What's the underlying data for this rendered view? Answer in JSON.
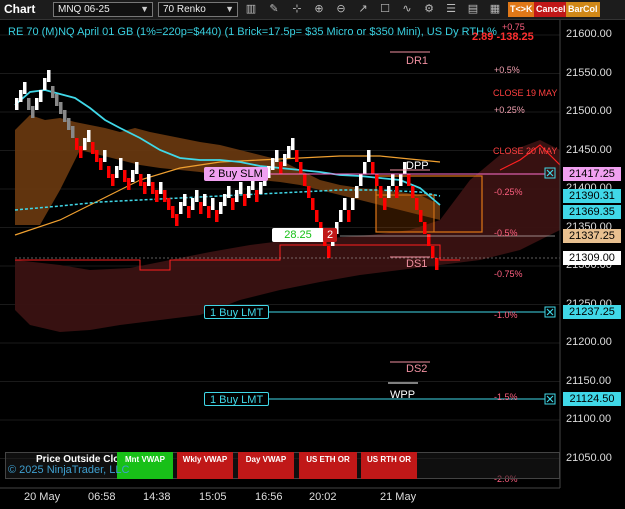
{
  "toolbar": {
    "title": "Chart",
    "instrument": "MNQ 06-25",
    "bar_type": "70 Renko",
    "badge_tk": "T<>K",
    "badge_cancel": "Cancel",
    "badge_barcol": "BarCol"
  },
  "header": {
    "description": "RE 70 (M)NQ April 01 GB (1%=220p=$440) (1 Brick=17.5p= $35 Micro or $350 Mini), US Dy RTH %",
    "pnl_label": "2.89",
    "pnl_value": "-138.25",
    "pnl_top": "+0.75"
  },
  "levels": {
    "dr1": "DR1",
    "dpp": "DPP",
    "ds1": "DS1",
    "ds2": "DS2",
    "wpp": "WPP",
    "pct_05": "+0.5%",
    "pct_025": "+0.25%",
    "close_19": "CLOSE 19 MAY",
    "close_20": "CLOSE 20 MAY",
    "pct_m025": "-0.25%",
    "pct_m05": "-0.5%",
    "pct_m075": "-0.75%",
    "pct_m10": "-1.0%",
    "pct_m15": "-1.5%",
    "pct_m20": "-2.0%"
  },
  "orders": {
    "buy_slm": "2 Buy SLM",
    "buy_lmt_1": "1 Buy LMT",
    "buy_lmt_2": "1 Buy LMT",
    "position_price": "28.25",
    "position_qty": "2"
  },
  "price_axis": {
    "ticks": [
      "21600.00",
      "21550.00",
      "21500.00",
      "21450.00",
      "21400.00",
      "21350.00",
      "21300.00",
      "21250.00",
      "21200.00",
      "21150.00",
      "21100.00",
      "21050.00"
    ],
    "tag_buy_slm": "21417.25",
    "tag_vwap": "21390.31",
    "tag_vwap2": "21369.35",
    "tag_pos": "21337.25",
    "tag_last": "21309.00",
    "tag_lmt1": "21237.25",
    "tag_lmt2": "21124.50"
  },
  "time_axis": [
    "20 May",
    "06:58",
    "14:38",
    "15:05",
    "16:56",
    "20:02",
    "21 May"
  ],
  "buttons": {
    "position": "Price Outside Clo",
    "mnt_vwap": "Mnt VWAP",
    "wkly_vwap": "Wkly VWAP",
    "day_vwap": "Day VWAP",
    "us_eth": "US ETH OR",
    "us_rth": "US RTH OR"
  },
  "copyright": "© 2025 NinjaTrader, LLC",
  "colors": {
    "accent_cyan": "#40d8e8",
    "bull_brick": "#ffffff",
    "bear_brick": "#ff0000",
    "cloud_up": "#6b3a10",
    "cloud_down": "#3a1212"
  }
}
